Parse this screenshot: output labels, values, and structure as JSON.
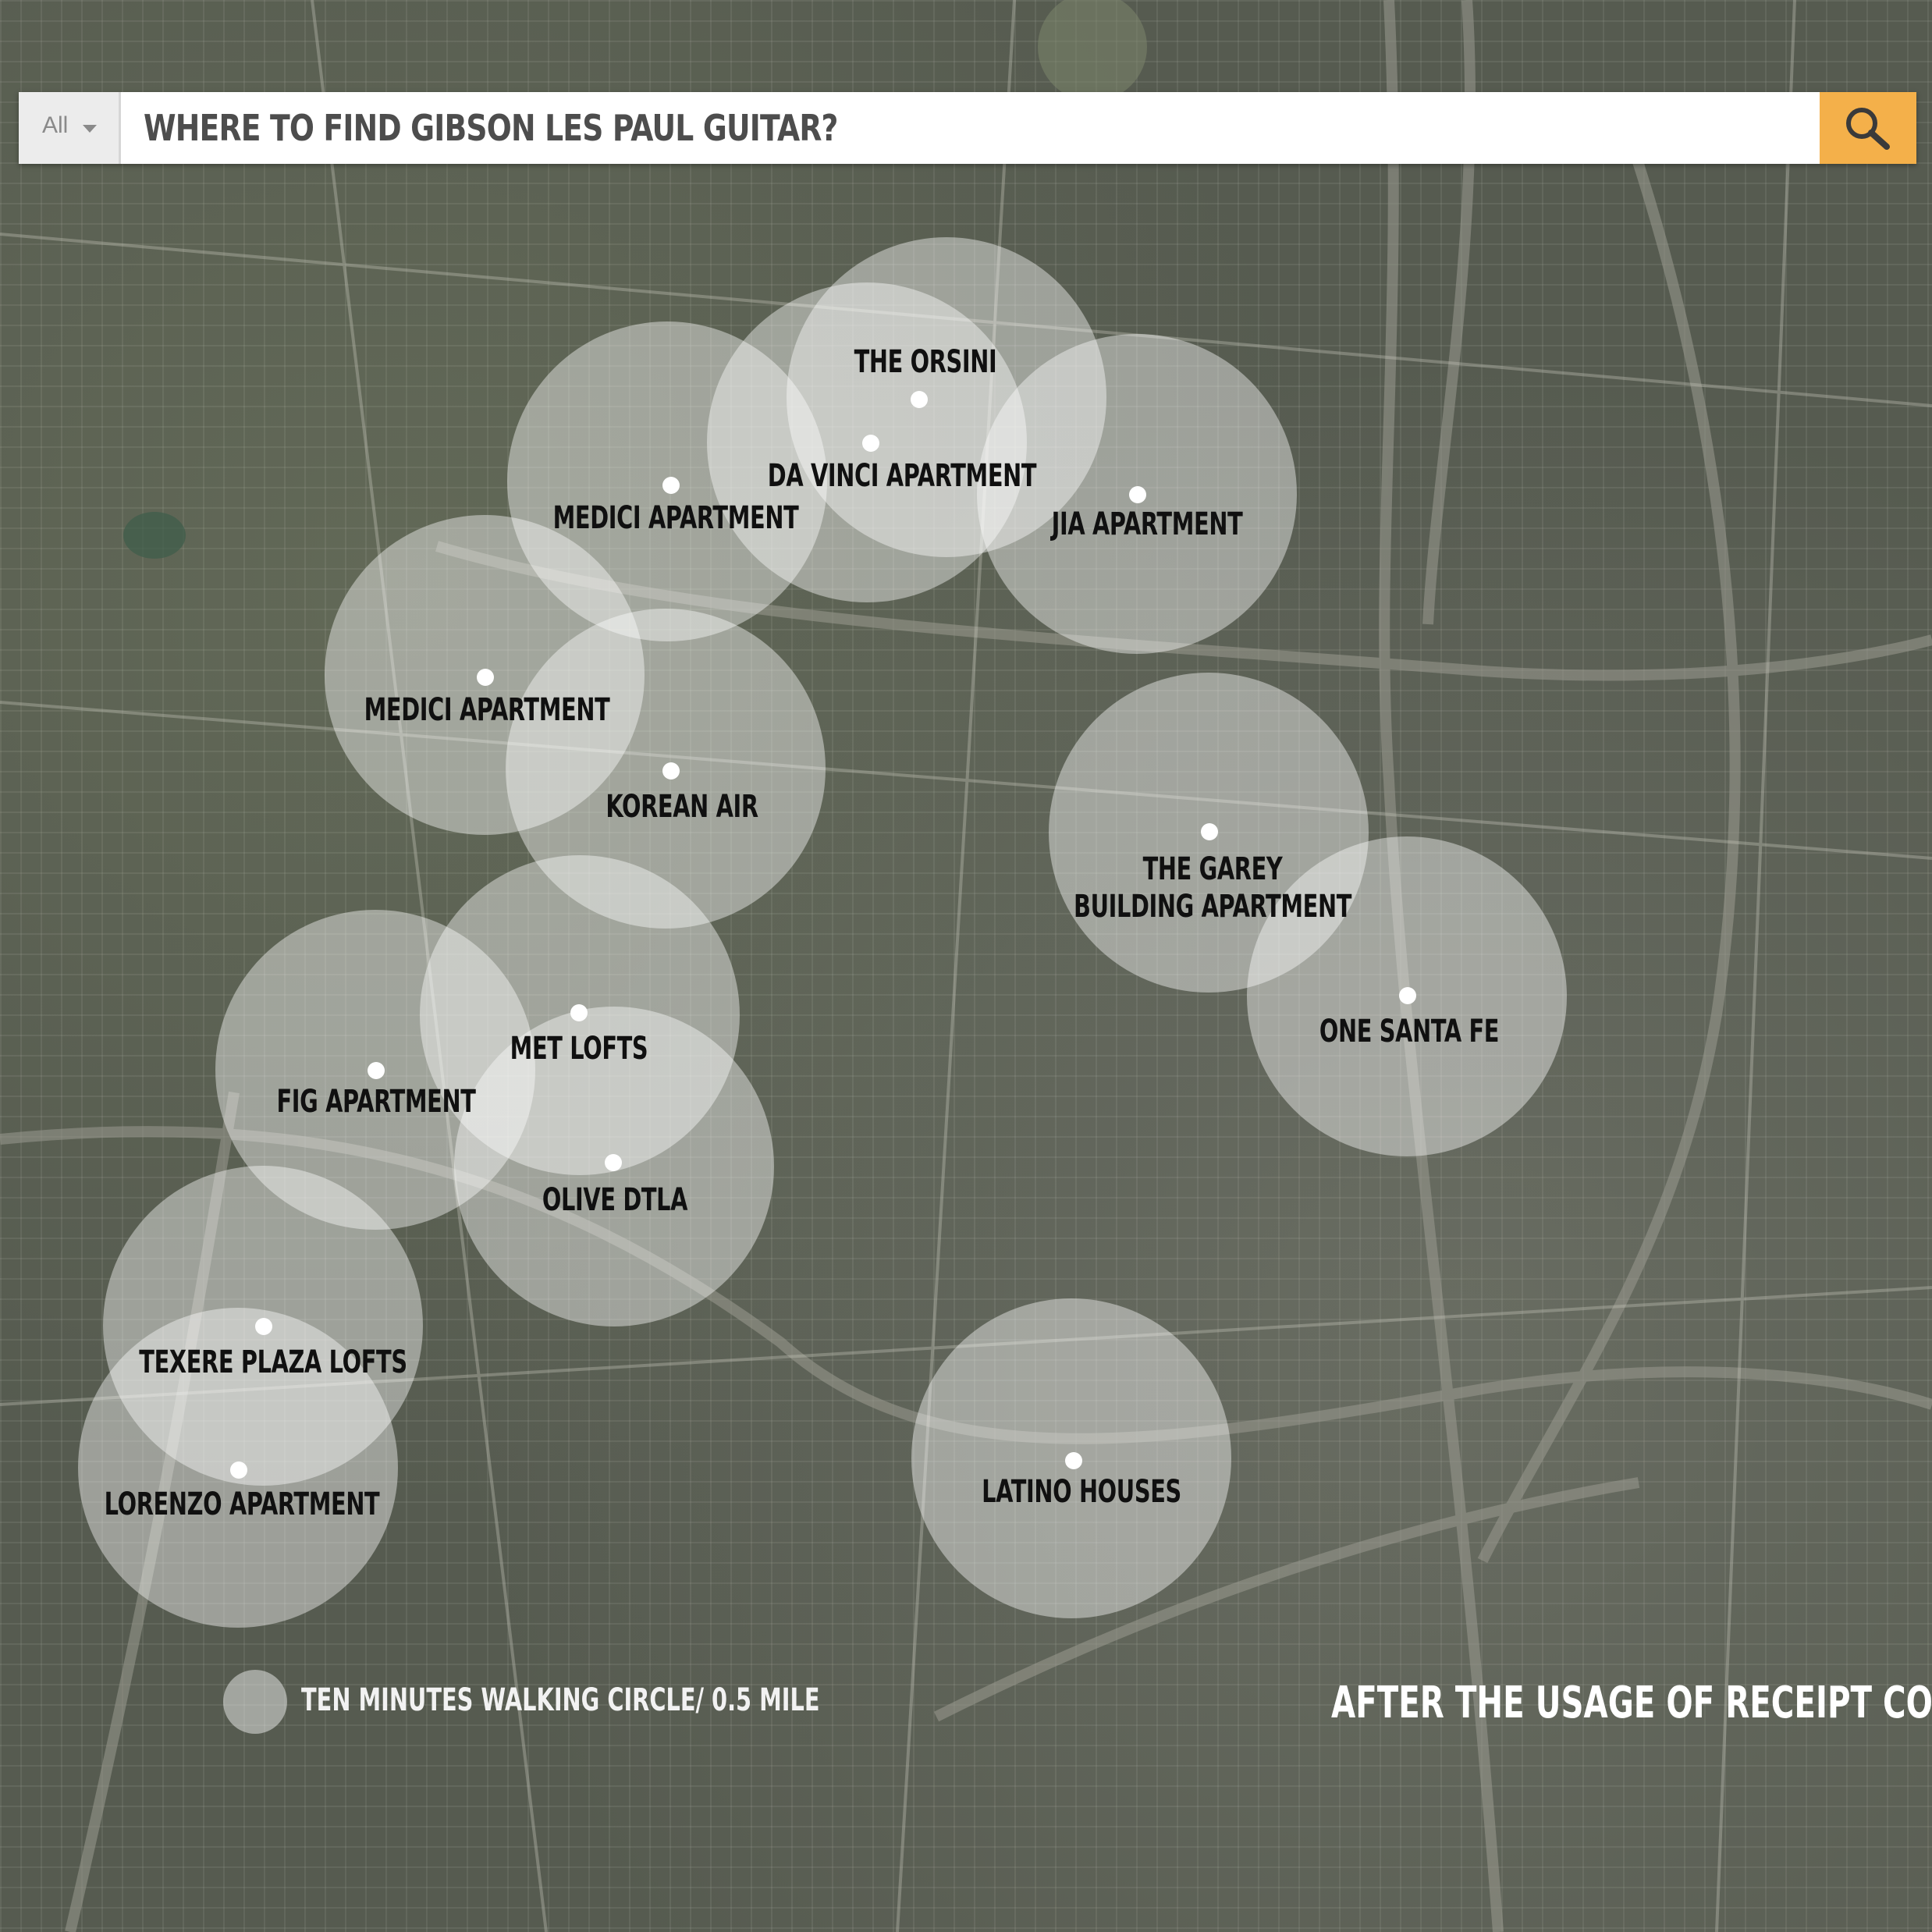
{
  "search": {
    "category": "All",
    "query": "WHERE TO FIND GIBSON LES PAUL GUITAR?"
  },
  "places": [
    {
      "name": "THE ORSINI"
    },
    {
      "name": "DA VINCI APARTMENT"
    },
    {
      "name": "MEDICI APARTMENT"
    },
    {
      "name": "JIA APARTMENT"
    },
    {
      "name": "MEDICI APARTMENT"
    },
    {
      "name": "KOREAN AIR"
    },
    {
      "name": "THE GAREY\nBUILDING APARTMENT"
    },
    {
      "name": "ONE SANTA FE"
    },
    {
      "name": "MET LOFTS"
    },
    {
      "name": "FIG APARTMENT"
    },
    {
      "name": "OLIVE DTLA"
    },
    {
      "name": "TEXERE PLAZA LOFTS"
    },
    {
      "name": "LORENZO APARTMENT"
    },
    {
      "name": "LATINO HOUSES"
    }
  ],
  "legend": {
    "label": "TEN MINUTES WALKING CIRCLE/ 0.5 MILE"
  },
  "caption": "AFTER THE USAGE OF RECEIPT COIN",
  "colors": {
    "search_button": "#f4b04a",
    "circle_fill": "rgba(255,255,255,0.42)",
    "label_text": "#101010"
  }
}
